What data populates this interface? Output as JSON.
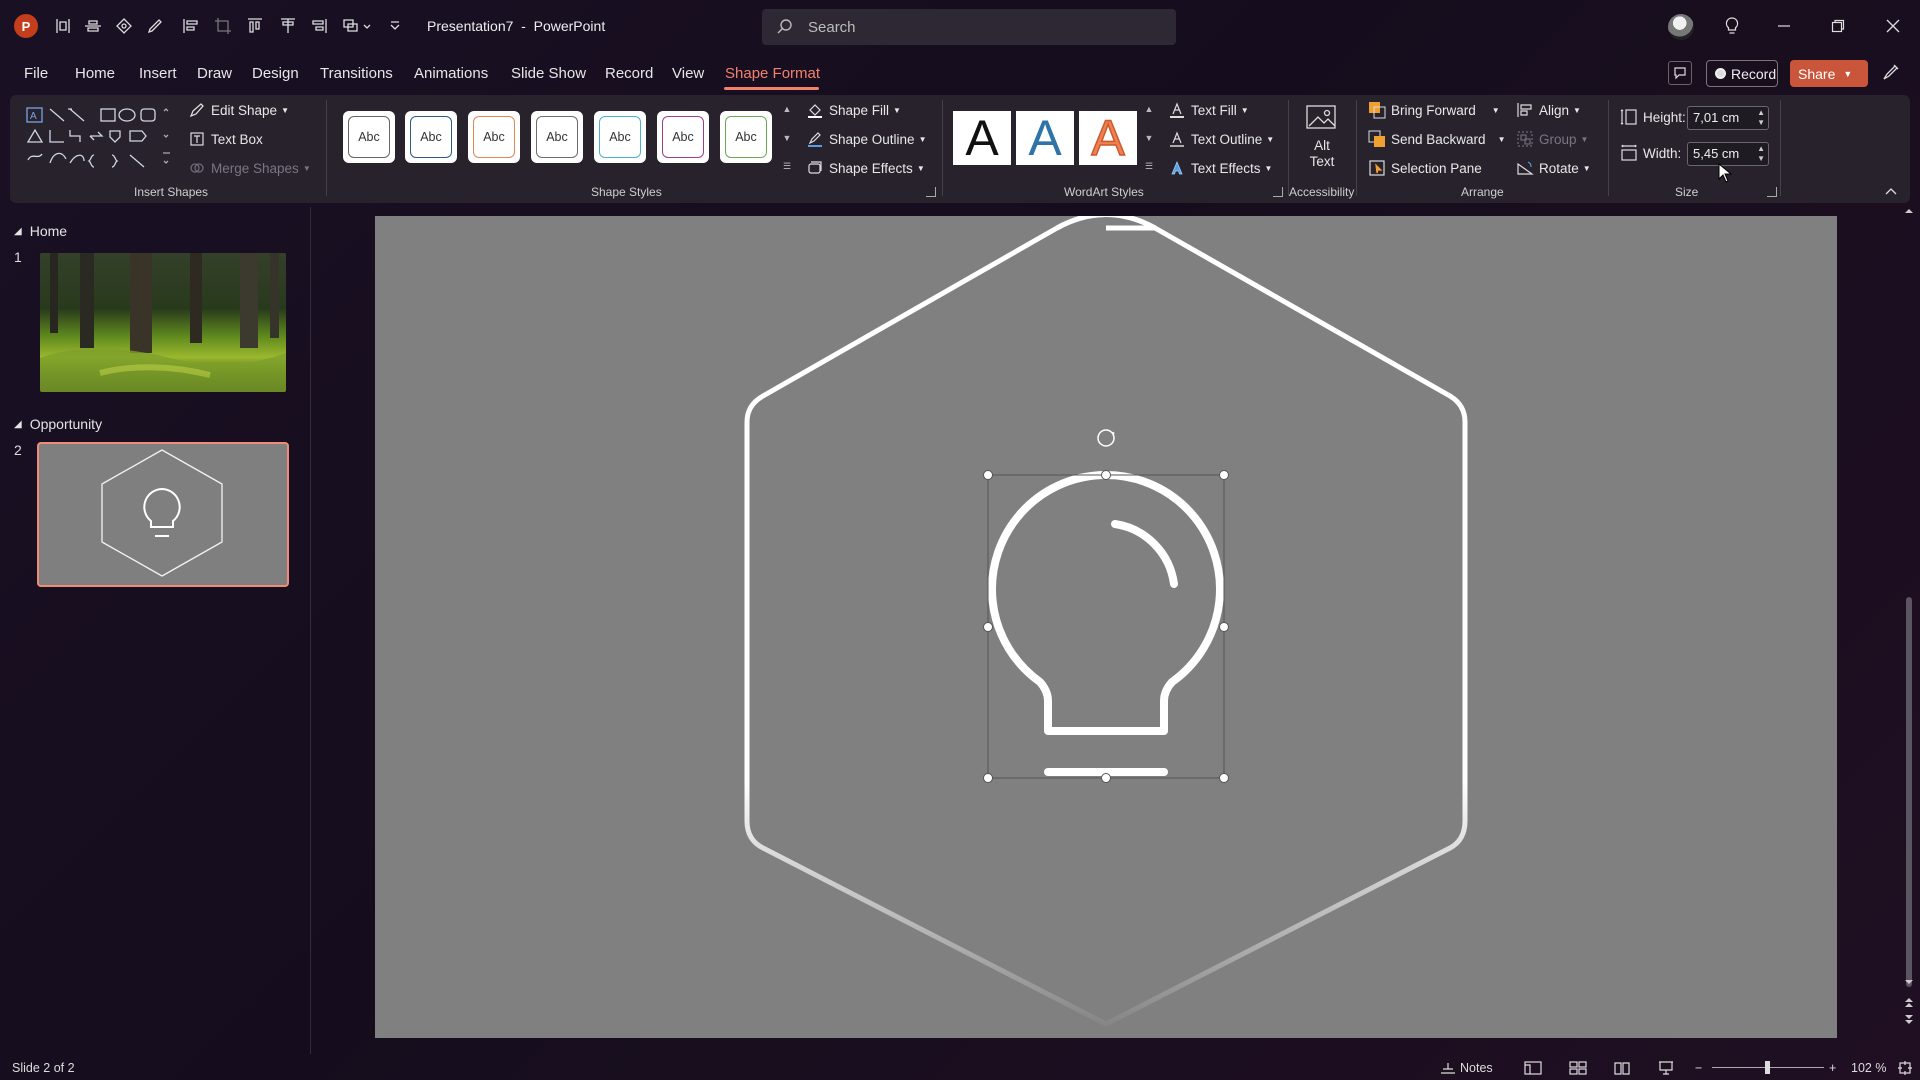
{
  "app": {
    "title": "Presentation7  -  PowerPoint",
    "logo": "P"
  },
  "search": {
    "placeholder": "Search"
  },
  "tabs": [
    {
      "label": "File"
    },
    {
      "label": "Home"
    },
    {
      "label": "Insert"
    },
    {
      "label": "Draw"
    },
    {
      "label": "Design"
    },
    {
      "label": "Transitions"
    },
    {
      "label": "Animations"
    },
    {
      "label": "Slide Show"
    },
    {
      "label": "Record"
    },
    {
      "label": "View"
    },
    {
      "label": "Shape Format",
      "active": true
    }
  ],
  "header_buttons": {
    "record": "Record",
    "share": "Share"
  },
  "ribbon": {
    "insert_shapes": {
      "label": "Insert Shapes",
      "edit_shape": "Edit Shape",
      "text_box": "Text Box",
      "merge_shapes": "Merge Shapes"
    },
    "shape_styles": {
      "label": "Shape Styles",
      "presets": [
        {
          "text": "Abc",
          "color": "#3a3a3a"
        },
        {
          "text": "Abc",
          "color": "#2e5a84"
        },
        {
          "text": "Abc",
          "color": "#e0875a"
        },
        {
          "text": "Abc",
          "color": "#6e6e6e"
        },
        {
          "text": "Abc",
          "color": "#4bb2d1"
        },
        {
          "text": "Abc",
          "color": "#9b3f8a"
        },
        {
          "text": "Abc",
          "color": "#6aa84f"
        }
      ],
      "shape_fill": "Shape Fill",
      "shape_outline": "Shape Outline",
      "shape_effects": "Shape Effects"
    },
    "wordart_styles": {
      "label": "WordArt Styles",
      "presets": [
        "A",
        "A",
        "A"
      ],
      "text_fill": "Text Fill",
      "text_outline": "Text Outline",
      "text_effects": "Text Effects"
    },
    "accessibility": {
      "label": "Accessibility",
      "alt_text_line1": "Alt",
      "alt_text_line2": "Text"
    },
    "arrange": {
      "label": "Arrange",
      "bring_forward": "Bring Forward",
      "send_backward": "Send Backward",
      "selection_pane": "Selection Pane",
      "align": "Align",
      "group": "Group",
      "rotate": "Rotate"
    },
    "size": {
      "label": "Size",
      "height_label": "Height:",
      "height_value": "7,01 cm",
      "width_label": "Width:",
      "width_value": "5,45 cm"
    }
  },
  "slides_pane": {
    "sections": [
      {
        "name": "Home",
        "slides": [
          {
            "number": "1",
            "content": "forest-photo"
          }
        ]
      },
      {
        "name": "Opportunity",
        "slides": [
          {
            "number": "2",
            "content": "hexagon-lightbulb",
            "selected": true
          }
        ]
      }
    ]
  },
  "canvas": {
    "background": "#808080",
    "selected_shape": "lightbulb-icon",
    "outline_color": "#ffffff"
  },
  "status": {
    "slide_info": "Slide 2 of 2",
    "notes": "Notes",
    "zoom": "102 %"
  },
  "colors": {
    "accent": "#f1826d",
    "share": "#c9553a",
    "ribbon_bg": "#27222c"
  }
}
